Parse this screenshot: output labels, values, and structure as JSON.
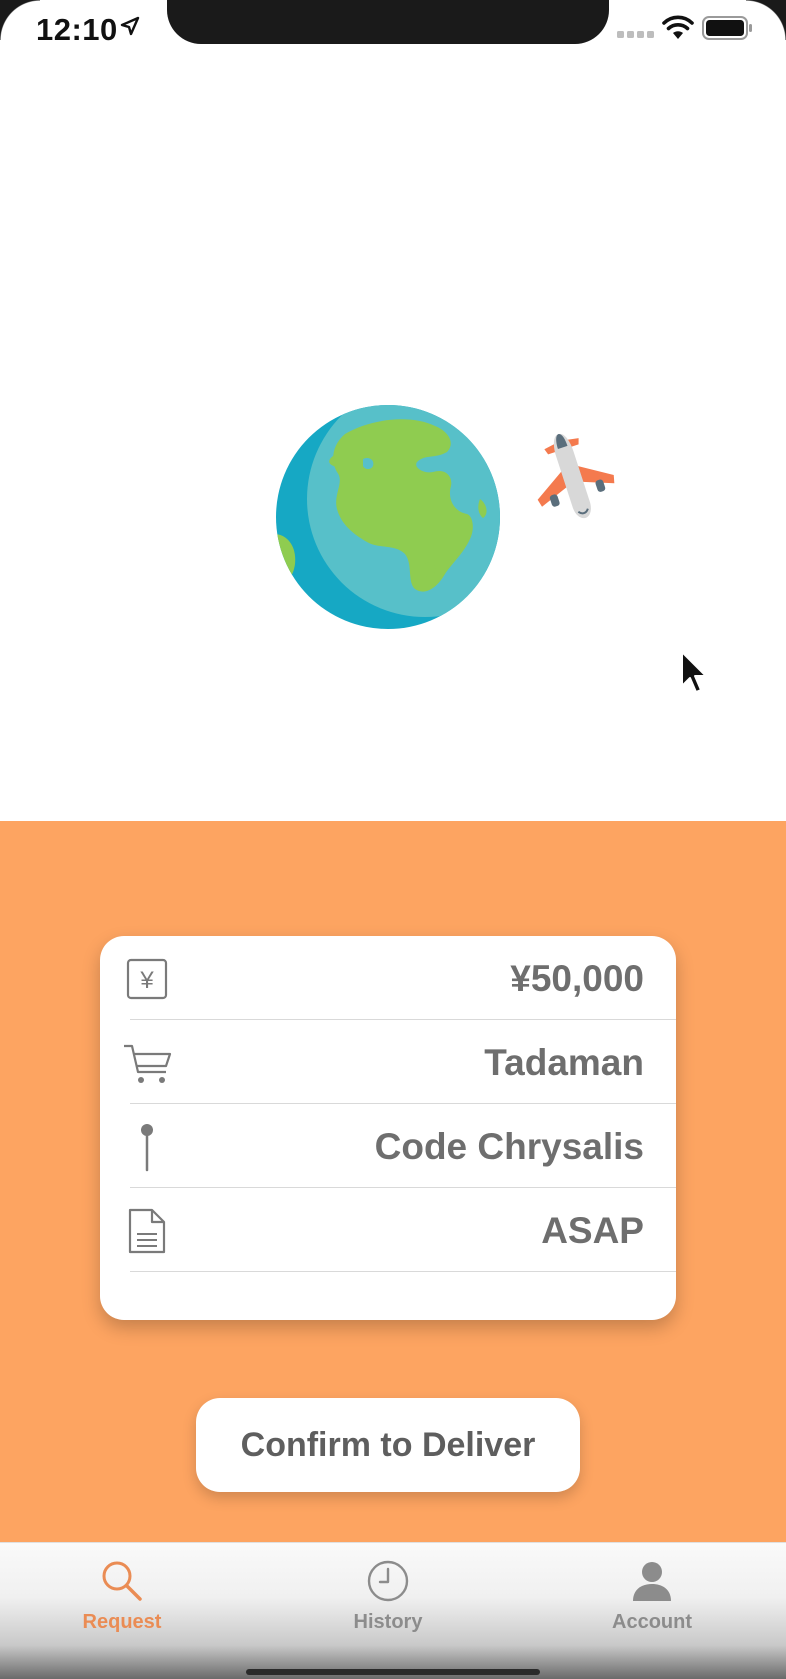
{
  "status_bar": {
    "time": "12:10",
    "icons": [
      "location-arrow-icon",
      "cellular-signal-icon",
      "wifi-icon",
      "battery-icon"
    ]
  },
  "hero": {
    "illustration": [
      "globe-icon",
      "airplane-icon"
    ]
  },
  "order_details": {
    "rows": [
      {
        "icon": "yen-icon",
        "value": "¥50,000"
      },
      {
        "icon": "cart-icon",
        "value": "Tadaman"
      },
      {
        "icon": "pin-icon",
        "value": "Code Chrysalis"
      },
      {
        "icon": "document-icon",
        "value": "ASAP"
      }
    ]
  },
  "confirm_button": {
    "label": "Confirm to Deliver"
  },
  "tab_bar": {
    "tabs": [
      {
        "icon": "search-icon",
        "label": "Request",
        "active": true
      },
      {
        "icon": "clock-icon",
        "label": "History",
        "active": false
      },
      {
        "icon": "person-icon",
        "label": "Account",
        "active": false
      }
    ]
  },
  "colors": {
    "accent_orange": "#fda461",
    "active_tab": "#ea8c54",
    "text_gray": "#6e6e6e",
    "inactive_tab": "#8c8c8c"
  }
}
